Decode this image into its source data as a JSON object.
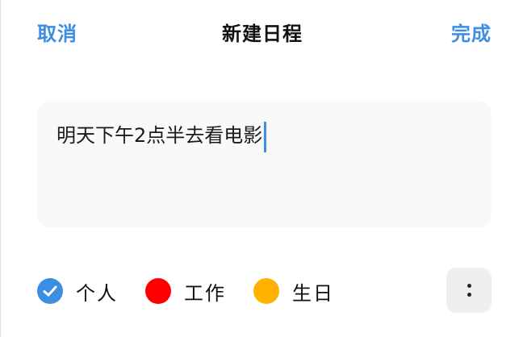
{
  "header": {
    "cancel_label": "取消",
    "title": "新建日程",
    "done_label": "完成"
  },
  "editor": {
    "text": "明天下午2点半去看电影"
  },
  "categories": [
    {
      "label": "个人",
      "color": "#3b8ee2",
      "selected": true,
      "icon": "check-icon"
    },
    {
      "label": "工作",
      "color": "#ff0000",
      "selected": false
    },
    {
      "label": "生日",
      "color": "#ffb300",
      "selected": false
    }
  ],
  "more_button": {
    "icon": "more-vertical-icon"
  },
  "colors": {
    "accent": "#3b8ee2"
  }
}
